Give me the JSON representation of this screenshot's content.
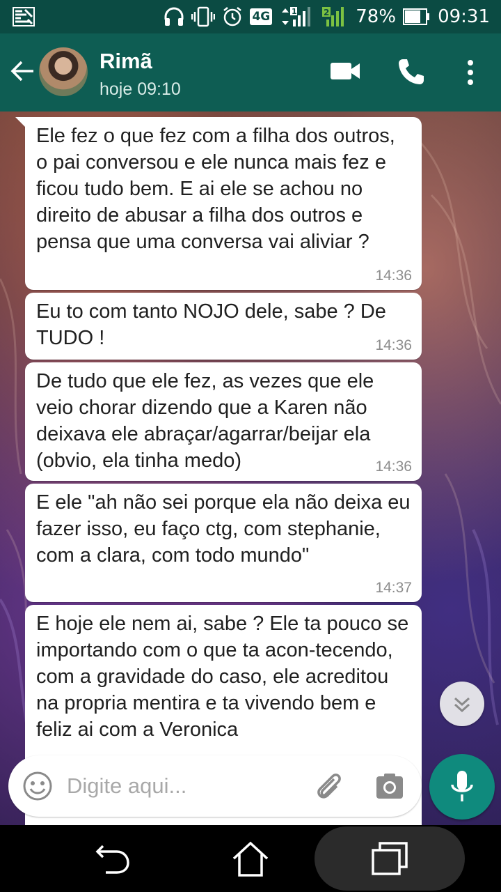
{
  "status_bar": {
    "network_type": "4G",
    "sim1_label": "1",
    "sim2_label": "2",
    "battery": "78%",
    "time": "09:31"
  },
  "header": {
    "contact_name": "Rimã",
    "last_seen": "hoje 09:10",
    "icons": [
      "back-arrow-icon",
      "video-call-icon",
      "phone-call-icon",
      "more-vert-icon"
    ]
  },
  "messages": [
    {
      "text": "Ele fez o que fez com a filha dos outros, o pai conversou e ele nunca mais fez e ficou tudo bem. E ai ele se achou no direito de abusar a filha dos outros e pensa que uma conversa vai aliviar ?",
      "time": "14:36"
    },
    {
      "text": "Eu to com tanto NOJO dele, sabe ? De TUDO !",
      "time": "14:36"
    },
    {
      "text": "De tudo que ele fez, as vezes que ele veio chorar dizendo que a Karen não deixava ele abraçar/agarrar/beijar ela (obvio, ela tinha medo)",
      "time": "14:36"
    },
    {
      "text": "E ele \"ah não sei porque ela não deixa eu fazer isso, eu faço ctg, com stephanie, com a clara, com todo mundo\"",
      "time": "14:37"
    },
    {
      "text": "E hoje ele nem ai, sabe ? Ele ta pouco se importando com o que ta acon-tecendo, com a gravidade do caso, ele acreditou na propria mentira e ta vivendo bem e feliz ai com a Veronica",
      "time": ""
    }
  ],
  "composer": {
    "placeholder": "Digite aqui..."
  },
  "colors": {
    "header": "#0e5d53",
    "status_bar": "#0b4b43",
    "accent": "#0f8a7d",
    "bubble": "#ffffff"
  }
}
